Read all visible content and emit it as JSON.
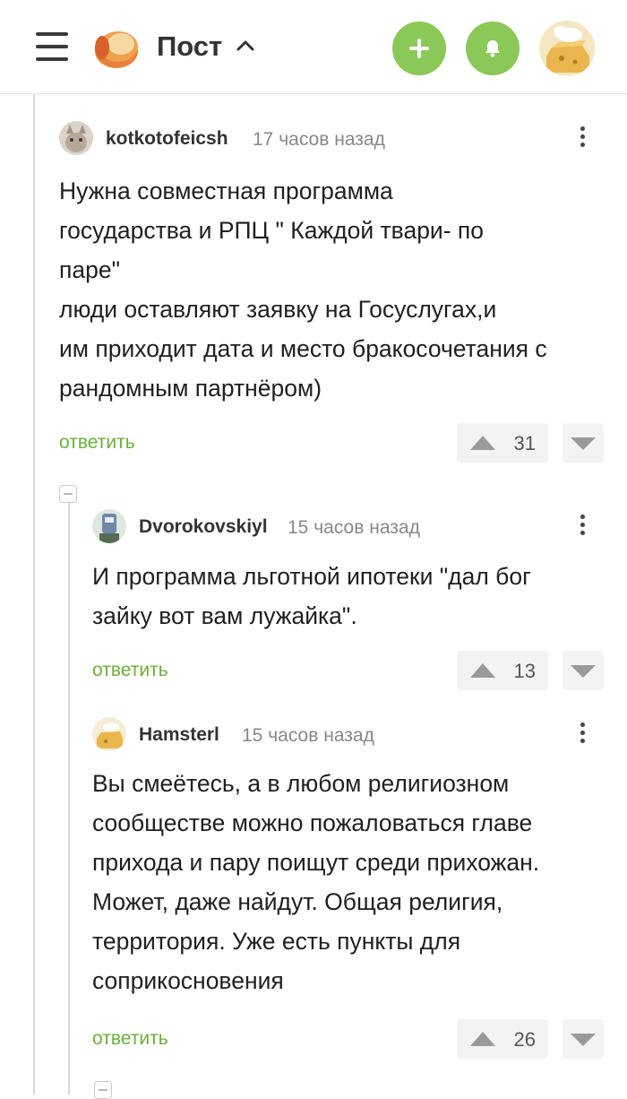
{
  "header": {
    "title": "Пост",
    "icons": {
      "menu": "menu-icon",
      "logo": "pikabu-logo",
      "add": "plus-icon",
      "notifications": "bell-icon",
      "avatar": "user-avatar"
    },
    "accent": "#8ac858"
  },
  "comments": [
    {
      "author": "kotkotofeicsh",
      "time": "17 часов назад",
      "lines": [
        "Нужна совместная программа",
        "государства и РПЦ \" Каждой твари- по",
        "паре\"",
        "люди оставляют заявку на Госуслугах,и",
        "им приходит дата и место бракосочетания с",
        "рандомным партнёром)"
      ],
      "reply_label": "ответить",
      "rating": "31"
    },
    {
      "author": "Dvorokovskiyl",
      "time": "15 часов назад",
      "lines": [
        "И программа льготной ипотеки \"дал бог",
        "зайку вот вам лужайка\"."
      ],
      "reply_label": "ответить",
      "rating": "13"
    },
    {
      "author": "Hamsterl",
      "time": "15 часов назад",
      "lines": [
        "Вы смеётесь, а в любом религиозном",
        "сообществе можно пожаловаться главе",
        "прихода и пару поищут среди прихожан.",
        "Может, даже найдут. Общая религия,",
        "территория. Уже есть пункты для",
        "соприкосновения"
      ],
      "reply_label": "ответить",
      "rating": "26"
    }
  ]
}
